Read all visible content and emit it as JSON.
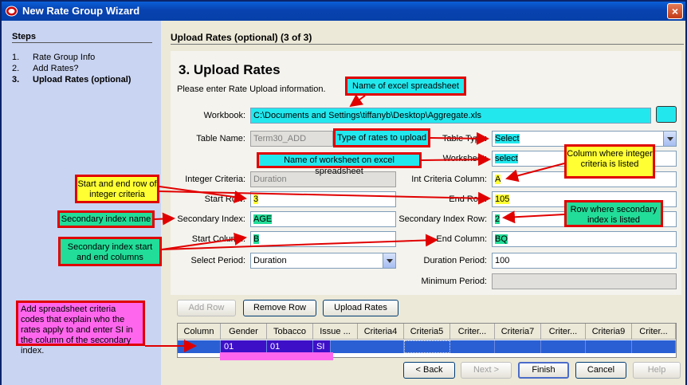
{
  "window": {
    "title": "New Rate Group Wizard",
    "close_glyph": "×"
  },
  "steps": {
    "heading": "Steps",
    "items": [
      {
        "num": "1.",
        "label": "Rate Group Info"
      },
      {
        "num": "2.",
        "label": "Add Rates?"
      },
      {
        "num": "3.",
        "label": "Upload Rates (optional)"
      }
    ]
  },
  "main": {
    "header": "Upload Rates (optional) (3 of 3)",
    "title": "3. Upload Rates",
    "subtitle": "Please enter Rate Upload information."
  },
  "form": {
    "workbook_label": "Workbook:",
    "workbook_value": "C:\\Documents and Settings\\tiffanyb\\Desktop\\Aggregate.xls",
    "browse_label": "...",
    "table_name_label": "Table Name:",
    "table_name_value": "Term30_ADD",
    "table_type_label": "Table Type:",
    "table_type_value": "Select",
    "worksheet_label": "Worksheet:",
    "worksheet_value": "select",
    "integer_criteria_label": "Integer Criteria:",
    "integer_criteria_value": "Duration",
    "int_criteria_column_label": "Int Criteria Column:",
    "int_criteria_column_value": "A",
    "start_row_label": "Start Row:",
    "start_row_value": "3",
    "end_row_label": "End Row:",
    "end_row_value": "105",
    "secondary_index_label": "Secondary Index:",
    "secondary_index_value": "AGE",
    "secondary_index_row_label": "Secondary Index Row:",
    "secondary_index_row_value": "2",
    "start_column_label": "Start Column:",
    "start_column_value": "B",
    "end_column_label": "End Column:",
    "end_column_value": "BQ",
    "select_period_label": "Select Period:",
    "select_period_value": "Duration",
    "duration_period_label": "Duration Period:",
    "duration_period_value": "100",
    "minimum_period_label": "Minimum Period:",
    "minimum_period_value": ""
  },
  "buttons": {
    "add_row": "Add Row",
    "remove_row": "Remove Row",
    "upload_rates": "Upload Rates",
    "back": "< Back",
    "next": "Next >",
    "finish": "Finish",
    "cancel": "Cancel",
    "help": "Help"
  },
  "grid": {
    "headers": [
      "Column",
      "Gender",
      "Tobacco",
      "Issue ...",
      "Criteria4",
      "Criteria5",
      "Criter...",
      "Criteria7",
      "Criter...",
      "Criteria9",
      "Criter..."
    ],
    "row": [
      "",
      "01",
      "01",
      "SI",
      "",
      "",
      "",
      "",
      "",
      "",
      ""
    ]
  },
  "annotations": {
    "excel": "Name of excel spreadsheet",
    "type_rates": "Type of rates to upload",
    "worksheet": "Name of worksheet on excel spreadsheet",
    "int_column": "Column where integer criteria is listed",
    "start_end_row": "Start and end row of integer criteria",
    "secondary_name": "Secondary index name",
    "secondary_row": "Row where secondary index is listed",
    "secondary_cols": "Secondary index start and end columns",
    "codes": "Add spreadsheet criteria codes that explain who the rates apply to and enter SI in the column of the secondary index."
  },
  "colors": {
    "annotation_border": "#e00000",
    "cyan": "#22e8ee",
    "yellow": "#ffff33",
    "green": "#22dd99",
    "pink": "#ff66ee",
    "selection": "#2a5fd4",
    "titlebar": "#0842b0"
  }
}
